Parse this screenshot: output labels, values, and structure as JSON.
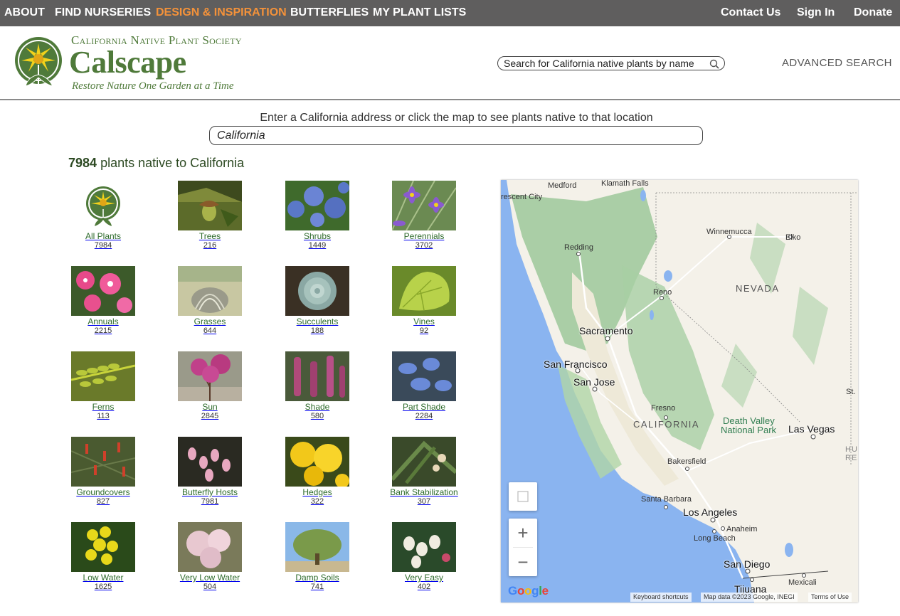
{
  "topnav": {
    "left": [
      {
        "label": "ABOUT",
        "active": false
      },
      {
        "label": "FIND NURSERIES",
        "active": false
      },
      {
        "label": "DESIGN & INSPIRATION",
        "active": true
      },
      {
        "label": "BUTTERFLIES",
        "active": false
      },
      {
        "label": "MY PLANT LISTS",
        "active": false
      }
    ],
    "right": [
      {
        "label": "Contact Us"
      },
      {
        "label": "Sign In"
      },
      {
        "label": "Donate"
      }
    ]
  },
  "brand": {
    "org": "California Native Plant Society",
    "name": "Calscape",
    "tagline": "Restore Nature One Garden at a Time"
  },
  "search": {
    "placeholder": "Search for California native plants by name",
    "advanced_label": "ADVANCED SEARCH"
  },
  "location": {
    "prompt": "Enter a California address or click the map to see plants native to that location",
    "value": "California"
  },
  "summary": {
    "count": "7984",
    "suffix": "plants native to California"
  },
  "categories": [
    {
      "label": "All Plants",
      "count": "7984",
      "icon": "calscape-logo"
    },
    {
      "label": "Trees",
      "count": "216",
      "icon": "acorn-photo"
    },
    {
      "label": "Shrubs",
      "count": "1449",
      "icon": "ceanothus-photo"
    },
    {
      "label": "Perennials",
      "count": "3702",
      "icon": "blue-eyed-grass-photo"
    },
    {
      "label": "Annuals",
      "count": "2215",
      "icon": "pink-flowers-photo"
    },
    {
      "label": "Grasses",
      "count": "644",
      "icon": "grass-photo"
    },
    {
      "label": "Succulents",
      "count": "188",
      "icon": "succulent-photo"
    },
    {
      "label": "Vines",
      "count": "92",
      "icon": "vine-leaf-photo"
    },
    {
      "label": "Ferns",
      "count": "113",
      "icon": "fern-photo"
    },
    {
      "label": "Sun",
      "count": "2845",
      "icon": "redbud-photo"
    },
    {
      "label": "Shade",
      "count": "580",
      "icon": "shade-plant-photo"
    },
    {
      "label": "Part Shade",
      "count": "2284",
      "icon": "blue-flowers-photo"
    },
    {
      "label": "Groundcovers",
      "count": "827",
      "icon": "groundcover-photo"
    },
    {
      "label": "Butterfly Hosts",
      "count": "7981",
      "icon": "manzanita-photo"
    },
    {
      "label": "Hedges",
      "count": "322",
      "icon": "yellow-flowers-photo"
    },
    {
      "label": "Bank Stabilization",
      "count": "307",
      "icon": "bank-plant-photo"
    },
    {
      "label": "Low Water",
      "count": "1625",
      "icon": "mahonia-photo"
    },
    {
      "label": "Very Low Water",
      "count": "504",
      "icon": "buckwheat-photo"
    },
    {
      "label": "Damp Soils",
      "count": "741",
      "icon": "willow-photo"
    },
    {
      "label": "Very Easy",
      "count": "402",
      "icon": "white-berries-photo"
    }
  ],
  "map": {
    "labels": [
      {
        "text": "Medford",
        "kind": "small"
      },
      {
        "text": "Klamath Falls",
        "kind": "small"
      },
      {
        "text": "rescent City",
        "kind": "small"
      },
      {
        "text": "Winnemucca",
        "kind": "small"
      },
      {
        "text": "Elko",
        "kind": "small"
      },
      {
        "text": "Redding",
        "kind": "small"
      },
      {
        "text": "Reno",
        "kind": "small"
      },
      {
        "text": "NEVADA",
        "kind": "region"
      },
      {
        "text": "Sacramento",
        "kind": "big"
      },
      {
        "text": "San Francisco",
        "kind": "big"
      },
      {
        "text": "San Jose",
        "kind": "big"
      },
      {
        "text": "St.",
        "kind": "small"
      },
      {
        "text": "Fresno",
        "kind": "small"
      },
      {
        "text": "CALIFORNIA",
        "kind": "region"
      },
      {
        "text": "Death Valley",
        "kind": "park"
      },
      {
        "text": "National Park",
        "kind": "park"
      },
      {
        "text": "Las Vegas",
        "kind": "big"
      },
      {
        "text": "HUALA",
        "kind": "small"
      },
      {
        "text": "RESE",
        "kind": "small"
      },
      {
        "text": "Bakersfield",
        "kind": "small"
      },
      {
        "text": "Santa Barbara",
        "kind": "small"
      },
      {
        "text": "Los Angeles",
        "kind": "big"
      },
      {
        "text": "Anaheim",
        "kind": "small"
      },
      {
        "text": "Long Beach",
        "kind": "small"
      },
      {
        "text": "San Diego",
        "kind": "big"
      },
      {
        "text": "Mexicali",
        "kind": "small"
      },
      {
        "text": "Tijuana",
        "kind": "big"
      }
    ],
    "controls": {
      "zoom_in": "+",
      "zoom_out": "−"
    },
    "google": "Google",
    "attribution": {
      "shortcuts": "Keyboard shortcuts",
      "data": "Map data ©2023 Google, INEGI",
      "terms": "Terms of Use"
    }
  }
}
